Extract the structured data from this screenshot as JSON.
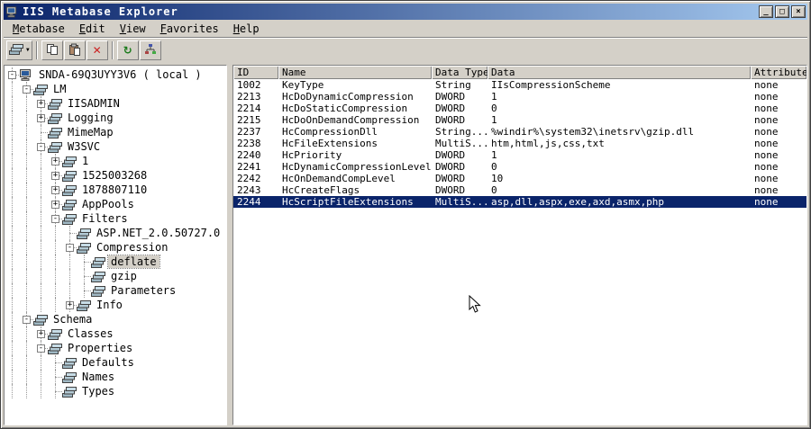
{
  "window": {
    "title": "IIS Metabase Explorer",
    "controls": {
      "minimize": "_",
      "maximize": "□",
      "close": "×"
    }
  },
  "menu": {
    "items": [
      "Metabase",
      "Edit",
      "View",
      "Favorites",
      "Help"
    ]
  },
  "toolbar": {
    "buttons": [
      {
        "icon": "connect-server-icon",
        "split": true
      },
      {
        "separator": true
      },
      {
        "icon": "copy-icon"
      },
      {
        "icon": "paste-icon"
      },
      {
        "icon": "delete-icon"
      },
      {
        "separator": true
      },
      {
        "icon": "refresh-icon"
      },
      {
        "icon": "network-icon"
      }
    ]
  },
  "tree": {
    "nodes": [
      {
        "depth": 0,
        "expander": "minus",
        "icon": "computer-icon",
        "label": "SNDA-69Q3UYY3V6 ( local )"
      },
      {
        "depth": 1,
        "expander": "minus",
        "icon": "metabase-node-icon",
        "label": "LM"
      },
      {
        "depth": 2,
        "expander": "plus",
        "icon": "metabase-node-icon",
        "label": "IISADMIN"
      },
      {
        "depth": 2,
        "expander": "plus",
        "icon": "metabase-node-icon",
        "label": "Logging"
      },
      {
        "depth": 2,
        "expander": null,
        "icon": "metabase-node-icon",
        "label": "MimeMap"
      },
      {
        "depth": 2,
        "expander": "minus",
        "icon": "metabase-node-icon",
        "label": "W3SVC"
      },
      {
        "depth": 3,
        "expander": "plus",
        "icon": "metabase-node-icon",
        "label": "1"
      },
      {
        "depth": 3,
        "expander": "plus",
        "icon": "metabase-node-icon",
        "label": "1525003268"
      },
      {
        "depth": 3,
        "expander": "plus",
        "icon": "metabase-node-icon",
        "label": "1878807110"
      },
      {
        "depth": 3,
        "expander": "plus",
        "icon": "metabase-node-icon",
        "label": "AppPools"
      },
      {
        "depth": 3,
        "expander": "minus",
        "icon": "metabase-node-icon",
        "label": "Filters"
      },
      {
        "depth": 4,
        "expander": null,
        "icon": "metabase-node-icon",
        "label": "ASP.NET_2.0.50727.0"
      },
      {
        "depth": 4,
        "expander": "minus",
        "icon": "metabase-node-icon",
        "label": "Compression"
      },
      {
        "depth": 5,
        "expander": null,
        "icon": "metabase-node-icon",
        "label": "deflate",
        "selected": true
      },
      {
        "depth": 5,
        "expander": null,
        "icon": "metabase-node-icon",
        "label": "gzip"
      },
      {
        "depth": 5,
        "expander": null,
        "icon": "metabase-node-icon",
        "label": "Parameters"
      },
      {
        "depth": 4,
        "expander": "plus",
        "icon": "metabase-node-icon",
        "label": "Info"
      },
      {
        "depth": 1,
        "expander": "minus",
        "icon": "metabase-node-icon",
        "label": "Schema"
      },
      {
        "depth": 2,
        "expander": "plus",
        "icon": "metabase-node-icon",
        "label": "Classes"
      },
      {
        "depth": 2,
        "expander": "minus",
        "icon": "metabase-node-icon",
        "label": "Properties"
      },
      {
        "depth": 3,
        "expander": null,
        "icon": "metabase-node-icon",
        "label": "Defaults"
      },
      {
        "depth": 3,
        "expander": null,
        "icon": "metabase-node-icon",
        "label": "Names"
      },
      {
        "depth": 3,
        "expander": null,
        "icon": "metabase-node-icon",
        "label": "Types"
      }
    ]
  },
  "list": {
    "columns": [
      "ID",
      "Name",
      "Data Type",
      "Data",
      "Attributes"
    ],
    "rows": [
      [
        "1002",
        "KeyType",
        "String",
        "IIsCompressionScheme",
        "none"
      ],
      [
        "2213",
        "HcDoDynamicCompression",
        "DWORD",
        "1",
        "none"
      ],
      [
        "2214",
        "HcDoStaticCompression",
        "DWORD",
        "0",
        "none"
      ],
      [
        "2215",
        "HcDoOnDemandCompression",
        "DWORD",
        "1",
        "none"
      ],
      [
        "2237",
        "HcCompressionDll",
        "String...",
        "%windir%\\system32\\inetsrv\\gzip.dll",
        "none"
      ],
      [
        "2238",
        "HcFileExtensions",
        "MultiS...",
        "htm,html,js,css,txt",
        "none"
      ],
      [
        "2240",
        "HcPriority",
        "DWORD",
        "1",
        "none"
      ],
      [
        "2241",
        "HcDynamicCompressionLevel",
        "DWORD",
        "0",
        "none"
      ],
      [
        "2242",
        "HcOnDemandCompLevel",
        "DWORD",
        "10",
        "none"
      ],
      [
        "2243",
        "HcCreateFlags",
        "DWORD",
        "0",
        "none"
      ],
      [
        "2244",
        "HcScriptFileExtensions",
        "MultiS...",
        "asp,dll,aspx,exe,axd,asmx,php",
        "none"
      ]
    ],
    "selected_id": "2244"
  },
  "colors": {
    "titlebar_start": "#0a246a",
    "titlebar_end": "#a6caf0",
    "chrome": "#d4d0c8",
    "selection": "#0a246a",
    "delete_red": "#cc2222",
    "refresh_green": "#1a7a1a"
  }
}
